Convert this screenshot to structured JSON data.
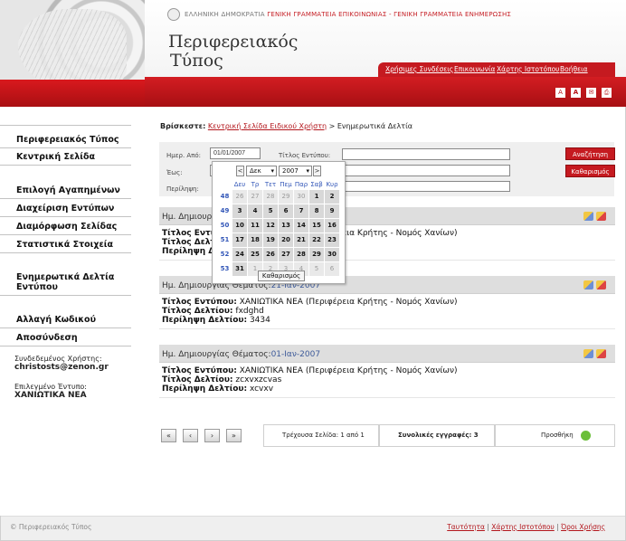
{
  "header": {
    "gov_prefix": "ΕΛΛΗΝΙΚΗ ΔΗΜΟΚΡΑΤΙΑ",
    "gov_secretariat_1": "ΓΕΝΙΚΗ ΓΡΑΜΜΑΤΕΙΑ ΕΠΙΚΟΙΝΩΝΙΑΣ",
    "gov_separator": "-",
    "gov_secretariat_2": "ΓΕΝΙΚΗ ΓΡΑΜΜΑΤΕΙΑ ΕΝΗΜΕΡΩΣΗΣ",
    "title_line1": "Περιφερειακός",
    "title_line2": "Τύπος",
    "nav": [
      "Χρήσιμες Συνδέσεις",
      "Επικοινωνία",
      "Χάρτης Ιστοτόπου",
      "Βοήθεια"
    ],
    "tool_icons": [
      "font-small-icon",
      "font-large-icon",
      "email-icon",
      "print-icon"
    ]
  },
  "sidebar": {
    "items": [
      "Περιφερειακός Τύπος",
      "Κεντρική Σελίδα",
      "Επιλογή Αγαπημένων",
      "Διαχείριση Εντύπων",
      "Διαμόρφωση Σελίδας",
      "Στατιστικά Στοιχεία",
      "Ενημερωτικά Δελτία",
      "Εντύπου",
      "Αλλαγή Κωδικού",
      "Αποσύνδεση"
    ],
    "user_label": "Συνδεδεμένος Χρήστης:",
    "user_value": "christosts@zenon.gr",
    "edition_label": "Επιλεγμένο Έντυπο:",
    "edition_value": "ΧΑΝΙΩΤΙΚΑ ΝΕΑ"
  },
  "breadcrumb": {
    "label": "Βρίσκεστε:",
    "link": "Κεντρική Σελίδα Ειδικού Χρήστη",
    "separator": ">",
    "current": "Ενημερωτικά Δελτία"
  },
  "search": {
    "date_from_label": "Ημερ. Από:",
    "date_from_value": "01/01/2007",
    "title_label": "Τίτλος Εντύπου:",
    "date_to_label": "Έως:",
    "summary_label": "Περίληψη:",
    "search_button": "Αναζήτηση",
    "clear_button": "Καθαρισμός"
  },
  "calendar": {
    "month": "Δεκ",
    "year": "2007",
    "prev": "<",
    "next": ">",
    "dd_arrow": "▾",
    "day_headers": [
      "Δευ",
      "Τρ",
      "Τετ",
      "Πεμ",
      "Παρ",
      "Σαβ",
      "Κυρ"
    ],
    "weeks": [
      {
        "week": "48",
        "days": [
          "26",
          "27",
          "28",
          "29",
          "30",
          "1",
          "2"
        ],
        "other": [
          true,
          true,
          true,
          true,
          true,
          false,
          false
        ]
      },
      {
        "week": "49",
        "days": [
          "3",
          "4",
          "5",
          "6",
          "7",
          "8",
          "9"
        ],
        "other": [
          false,
          false,
          false,
          false,
          false,
          false,
          false
        ]
      },
      {
        "week": "50",
        "days": [
          "10",
          "11",
          "12",
          "13",
          "14",
          "15",
          "16"
        ],
        "other": [
          false,
          false,
          false,
          false,
          false,
          false,
          false
        ]
      },
      {
        "week": "51",
        "days": [
          "17",
          "18",
          "19",
          "20",
          "21",
          "22",
          "23"
        ],
        "other": [
          false,
          false,
          false,
          false,
          false,
          false,
          false
        ]
      },
      {
        "week": "52",
        "days": [
          "24",
          "25",
          "26",
          "27",
          "28",
          "29",
          "30"
        ],
        "other": [
          false,
          false,
          false,
          false,
          false,
          false,
          false
        ]
      },
      {
        "week": "53",
        "days": [
          "31",
          "1",
          "2",
          "3",
          "4",
          "5",
          "6"
        ],
        "other": [
          false,
          true,
          true,
          true,
          true,
          true,
          true
        ]
      }
    ],
    "clear_button": "Καθαρισμός"
  },
  "records": [
    {
      "date_label": "Ημ. Δημιουργίας Θέματος:",
      "date": "",
      "title_label": "Τίτλος Εντύπου:",
      "title": "ΧΑΝΙΩΤΙΚΑ ΝΕΑ",
      "region": "(Περιφέρεια Κρήτης - Νομός Χανίων)",
      "bulletin_label": "Τίτλος Δελτίου:",
      "bulletin": "",
      "summary_label": "Περίληψη Δελτίου:",
      "summary": ""
    },
    {
      "date_label": "Ημ. Δημιουργίας Θέματος:",
      "date": "21-Ιαν-2007",
      "title_label": "Τίτλος Εντύπου:",
      "title": "ΧΑΝΙΩΤΙΚΑ ΝΕΑ",
      "region": "(Περιφέρεια Κρήτης - Νομός Χανίων)",
      "bulletin_label": "Τίτλος Δελτίου:",
      "bulletin": "fxdghd",
      "summary_label": "Περίληψη Δελτίου:",
      "summary": "3434"
    },
    {
      "date_label": "Ημ. Δημιουργίας Θέματος:",
      "date": "01-Ιαν-2007",
      "title_label": "Τίτλος Εντύπου:",
      "title": "ΧΑΝΙΩΤΙΚΑ ΝΕΑ",
      "region": "(Περιφέρεια Κρήτης - Νομός Χανίων)",
      "bulletin_label": "Τίτλος Δελτίου:",
      "bulletin": "zcxvxzcvas",
      "summary_label": "Περίληψη Δελτίου:",
      "summary": "xcvxv"
    }
  ],
  "pager": {
    "first": "«",
    "prev": "‹",
    "next": "›",
    "last": "»",
    "page_info": "Τρέχουσα Σελίδα: 1 από 1",
    "total_label": "Συνολικές εγγραφές:",
    "total_value": "3",
    "forward_label": "Προσθήκη"
  },
  "footer": {
    "copyright": "© Περιφερειακός Τύπος",
    "links": [
      "Ταυτότητα",
      "Χάρτης Ιστοτόπου",
      "Όροι Χρήσης"
    ],
    "separator": "|"
  },
  "colors": {
    "brand_red": "#c51a20",
    "link_blue": "#3d5a99"
  }
}
